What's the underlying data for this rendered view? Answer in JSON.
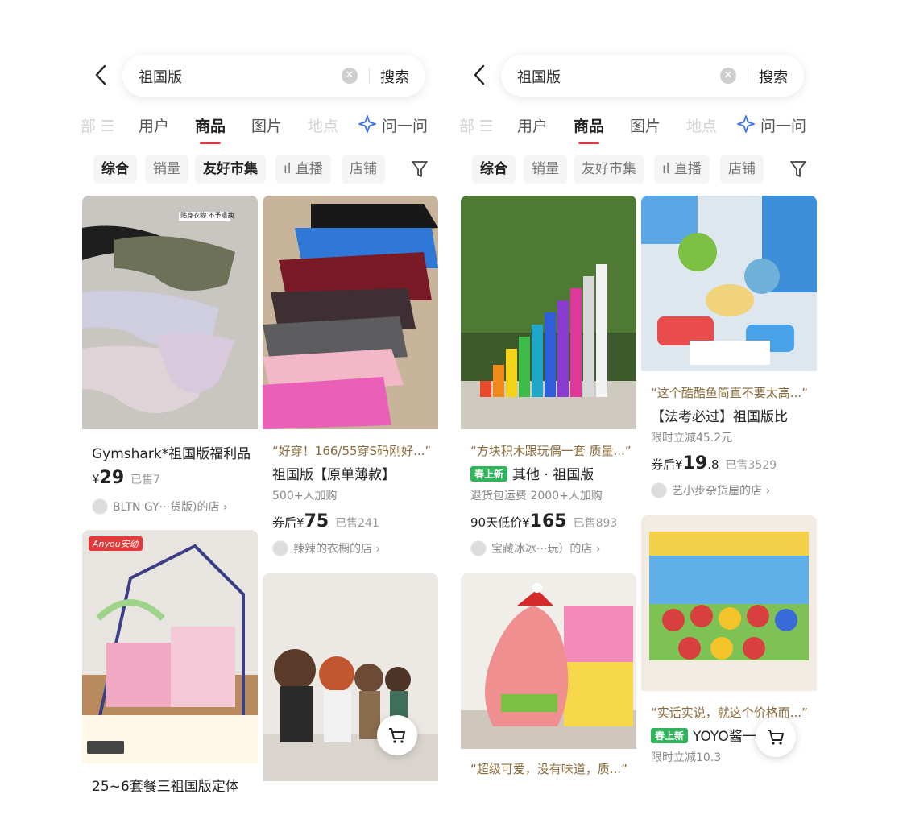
{
  "search": {
    "query": "祖国版",
    "button_label": "搜索"
  },
  "tabs": {
    "partial_all": "部",
    "users": "用户",
    "products": "商品",
    "images": "图片",
    "places": "地点",
    "ask": "问一问"
  },
  "filters": {
    "overall": "综合",
    "sales": "销量",
    "friendly_market": "友好市集",
    "live": "直播",
    "shops": "店铺"
  },
  "left": {
    "card1": {
      "title": "Gymshark*祖国版福利品",
      "currency": "¥",
      "price": "29",
      "sold": "已售7",
      "shop": "BLTN GY···货版)的店",
      "image_caption": "贴身衣物 不予退换"
    },
    "card2": {
      "quote": "“好穿！166/55穿S码刚好...”",
      "title": "祖国版【原单薄款】",
      "sub": "500+人加购",
      "prefix": "券后",
      "currency": "¥",
      "price": "75",
      "sold": "已售241",
      "shop": "辣辣的衣橱的店"
    },
    "card3": {
      "brand": "Anyou安幼",
      "title_partial": "25~6套餐三祖国版定体"
    },
    "card4": {}
  },
  "right": {
    "card1": {
      "quote": "“方块积木跟玩偶一套 质量...”",
      "badge": "春上新",
      "title": "其他 · 祖国版",
      "sub": "退货包运费  2000+人加购",
      "prefix": "90天低价",
      "currency": "¥",
      "price": "165",
      "sold": "已售893",
      "shop": "宝藏冰冰···玩）的店"
    },
    "card2": {
      "quote": "“这个酷酷鱼简直不要太高...”",
      "title": "【法考必过】祖国版比",
      "sub": "限时立减45.2元",
      "prefix": "券后",
      "currency": "¥",
      "price": "19",
      "price_decimal": ".8",
      "sold": "已售3529",
      "shop": "艺小步杂货屋的店"
    },
    "card3": {
      "quote": "“超级可爱，没有味道，质...”"
    },
    "card4": {
      "quote": "“实话实说，就这个价格而...”",
      "badge": "春上新",
      "title": "YOYO酱一",
      "sub": "限时立减10.3"
    }
  },
  "colors": {
    "accent": "#e5334b",
    "badge_green": "#2fb35b",
    "quote_brown": "#8a6a3a",
    "chip_bg": "#f5f5f5"
  },
  "icons": [
    "back-arrow-icon",
    "clear-icon",
    "filter-lines-icon",
    "ask-sparkle-icon",
    "chart-bars-icon",
    "funnel-icon",
    "cart-icon",
    "chevron-right-icon"
  ]
}
